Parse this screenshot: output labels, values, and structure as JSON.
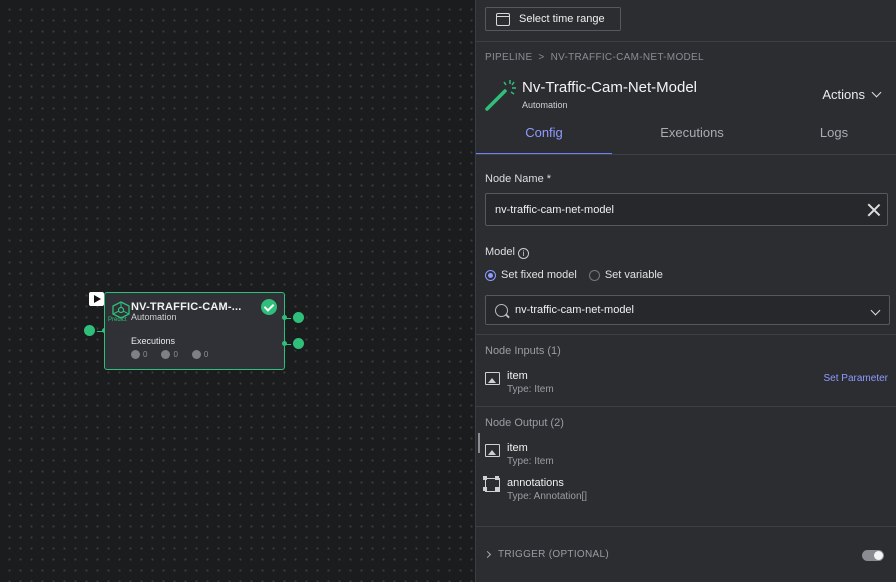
{
  "canvas": {
    "node": {
      "title": "NV-TRAFFIC-CAM-...",
      "subtitle": "Automation",
      "icon_label": "Predict",
      "executions_label": "Executions",
      "stats": [
        {
          "icon": "queue-icon",
          "value": "0"
        },
        {
          "icon": "success-icon",
          "value": "0"
        },
        {
          "icon": "failed-icon",
          "value": "0"
        }
      ],
      "status_color": "#2fbf7a"
    }
  },
  "panel": {
    "time_range_label": "Select time range",
    "breadcrumb": {
      "root": "PIPELINE",
      "separator": ">",
      "current": "NV-TRAFFIC-CAM-NET-MODEL"
    },
    "header": {
      "title": "Nv-Traffic-Cam-Net-Model",
      "subtitle": "Automation",
      "actions_label": "Actions"
    },
    "tabs": [
      {
        "label": "Config",
        "active": true
      },
      {
        "label": "Executions",
        "active": false
      },
      {
        "label": "Logs",
        "active": false
      }
    ],
    "node_name": {
      "label": "Node Name *",
      "value": "nv-traffic-cam-net-model"
    },
    "model": {
      "label": "Model",
      "options": [
        {
          "label": "Set fixed model",
          "selected": true
        },
        {
          "label": "Set variable",
          "selected": false
        }
      ],
      "selected_value": "nv-traffic-cam-net-model"
    },
    "inputs": {
      "title": "Node Inputs (1)",
      "items": [
        {
          "name": "item",
          "type": "Type: Item"
        }
      ],
      "set_parameter_label": "Set Parameter"
    },
    "outputs": {
      "title": "Node Output (2)",
      "items": [
        {
          "name": "item",
          "type": "Type: Item"
        },
        {
          "name": "annotations",
          "type": "Type: Annotation[]"
        }
      ]
    },
    "trigger_label": "TRIGGER (OPTIONAL)",
    "accent_color": "#8f9bff"
  }
}
